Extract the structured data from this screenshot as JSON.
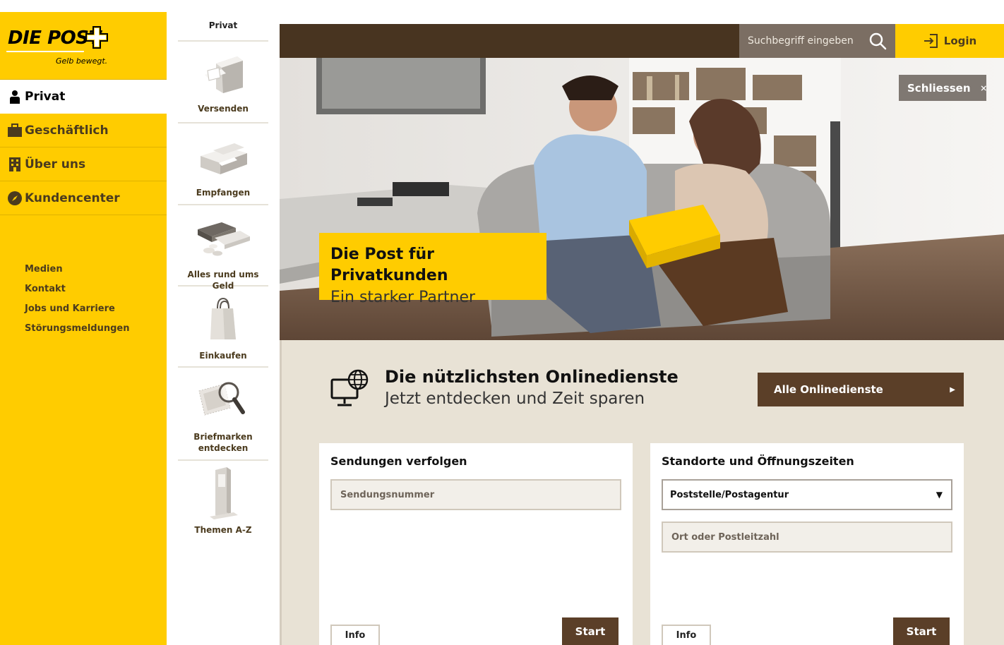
{
  "logo": {
    "brand": "DIE POST",
    "slogan": "Gelb bewegt."
  },
  "colors": {
    "brand_yellow": "#ffcc00",
    "dark_brown": "#483420",
    "button_brown": "#5b3f28",
    "beige": "#e8e2d5",
    "search_gray": "#7b6e63"
  },
  "sidebar": {
    "items": [
      {
        "label": "Privat",
        "icon": "person-icon",
        "active": true
      },
      {
        "label": "Geschäftlich",
        "icon": "briefcase-icon",
        "active": false
      },
      {
        "label": "Über uns",
        "icon": "building-icon",
        "active": false
      },
      {
        "label": "Kundencenter",
        "icon": "compass-icon",
        "active": false
      }
    ],
    "links": [
      "Medien",
      "Kontakt",
      "Jobs und Karriere",
      "Störungsmeldungen"
    ]
  },
  "subnav": {
    "heading": "Privat",
    "items": [
      {
        "label": "Versenden",
        "icon": "mailbox-icon"
      },
      {
        "label": "Empfangen",
        "icon": "parcel-icon"
      },
      {
        "label": "Alles rund ums Geld",
        "icon": "wallet-coins-icon"
      },
      {
        "label": "Einkaufen",
        "icon": "shopping-bag-icon"
      },
      {
        "label": "Briefmarken entdecken",
        "icon": "stamp-magnifier-icon"
      },
      {
        "label": "Themen A-Z",
        "icon": "terminal-icon"
      }
    ]
  },
  "header": {
    "search_placeholder": "Suchbegriff eingeben",
    "login_label": "Login"
  },
  "hero": {
    "close_label": "Schliessen",
    "title": "Die Post für Privatkunden",
    "subtitle": "Ein starker Partner"
  },
  "online": {
    "title": "Die nützlichsten Onlinedienste",
    "subtitle": "Jetzt entdecken und Zeit sparen",
    "button_label": "Alle Onlinedienste"
  },
  "tracking": {
    "title": "Sendungen verfolgen",
    "placeholder": "Sendungsnummer",
    "info_label": "Info",
    "start_label": "Start"
  },
  "locations": {
    "title": "Standorte und Öffnungszeiten",
    "select_value": "Poststelle/Postagentur",
    "placeholder": "Ort oder Postleitzahl",
    "info_label": "Info",
    "start_label": "Start"
  }
}
